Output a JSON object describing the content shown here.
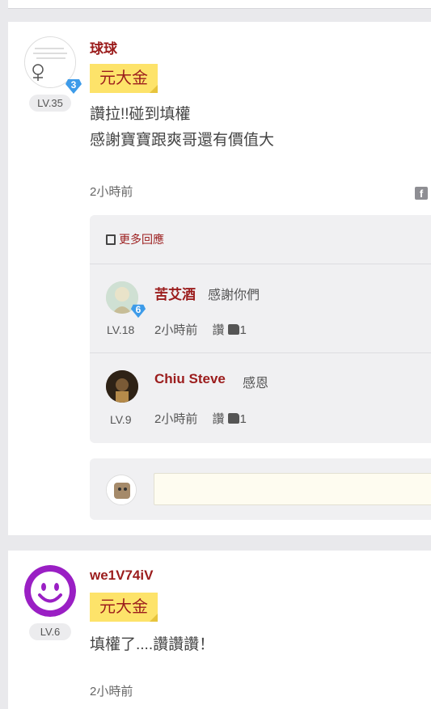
{
  "posts": [
    {
      "username": "球球",
      "level": "LV.35",
      "gem_level": "3",
      "stock": "元大金",
      "lines": [
        "讚拉!!碰到填權",
        "感謝寶寶跟爽哥還有價值大"
      ],
      "time": "2小時前",
      "more_replies_label": "更多回應",
      "replies": [
        {
          "username": "苦艾酒",
          "text": "感謝你們",
          "level": "LV.18",
          "gem_level": "6",
          "time": "2小時前",
          "like_label": "讚",
          "like_count": "1"
        },
        {
          "username": "Chiu Steve",
          "text": "感恩",
          "level": "LV.9",
          "time": "2小時前",
          "like_label": "讚",
          "like_count": "1"
        }
      ],
      "reply_input": {
        "placeholder": ""
      }
    },
    {
      "username": "we1V74iV",
      "level": "LV.6",
      "stock": "元大金",
      "lines": [
        "填權了....讚讚讚！"
      ],
      "time": "2小時前"
    }
  ],
  "colors": {
    "username": "#9b1c1c",
    "stock_tag_bg": "#fde36a",
    "gem": "#3d9be9",
    "avatar_purple": "#9a1fc4"
  },
  "icons": {
    "share": "facebook-icon",
    "more_replies": "document-icon",
    "like": "thumbs-up-icon"
  }
}
